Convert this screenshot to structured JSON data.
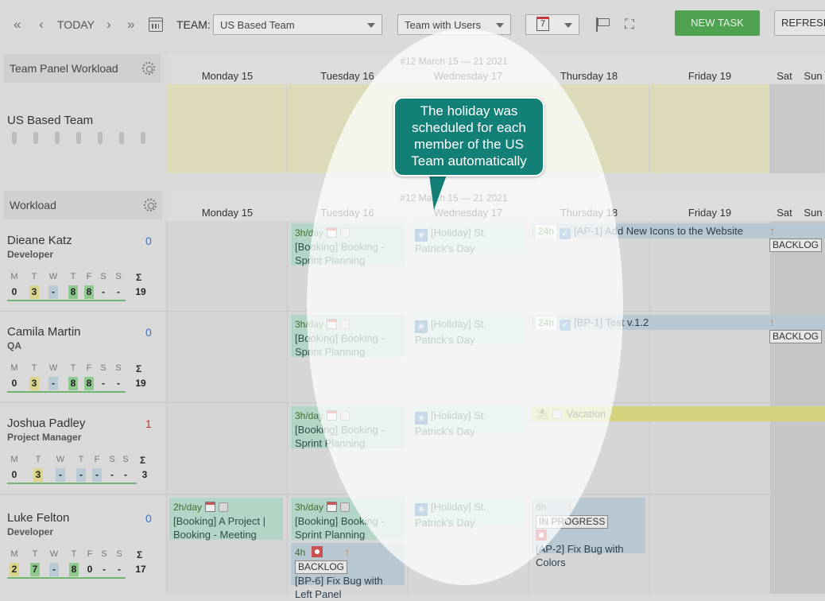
{
  "toolbar": {
    "today_label": "TODAY",
    "team_label": "TEAM:",
    "team_select_value": "US Based Team",
    "view_select_value": "Team with Users",
    "day_number": "7",
    "new_task_label": "NEW TASK",
    "refresh_label": "REFRESH",
    "icons": [
      "double-chevron-left-icon",
      "chevron-left-icon",
      "chevron-right-icon",
      "double-chevron-right-icon",
      "calendar-grid-icon",
      "calendar-day-icon",
      "flag-icon",
      "expand-icon"
    ]
  },
  "team_panel": {
    "title": "Team Panel Workload",
    "team_name": "US Based Team",
    "week_label": "#12 March 15 — 21 2021"
  },
  "workload_panel": {
    "title": "Workload",
    "week_label": "#12 March 15 — 21 2021"
  },
  "days": [
    "Monday 15",
    "Tuesday 16",
    "Wednesday 17",
    "Thursday 18",
    "Friday 19",
    "Sat",
    "Sun"
  ],
  "weekday_letters": [
    "M",
    "T",
    "W",
    "T",
    "F",
    "S",
    "S",
    "Σ"
  ],
  "members": [
    {
      "name": "Dieane Katz",
      "role": "Developer",
      "count": "0",
      "count_color": "#3b73c0",
      "week_values": [
        "0",
        "3",
        "-",
        "8",
        "8",
        "-",
        "-"
      ],
      "total": "19"
    },
    {
      "name": "Camila Martin",
      "role": "QA",
      "count": "0",
      "count_color": "#3b73c0",
      "week_values": [
        "0",
        "3",
        "-",
        "8",
        "8",
        "-",
        "-"
      ],
      "total": "19"
    },
    {
      "name": "Joshua Padley",
      "role": "Project Manager",
      "count": "1",
      "count_color": "#c0392b",
      "week_values": [
        "0",
        "3",
        "-",
        "-",
        "-",
        "-",
        "-"
      ],
      "total": "3"
    },
    {
      "name": "Luke Felton",
      "role": "Developer",
      "count": "0",
      "count_color": "#3b73c0",
      "week_values": [
        "2",
        "7",
        "-",
        "8",
        "0",
        "-",
        "-"
      ],
      "total": "17"
    }
  ],
  "cards": {
    "booking_rate": "3h/day",
    "booking_text": "[Booking] Booking - Sprint Planning",
    "holiday_text": "[Holiday] St. Patrick's Day",
    "task1_hours": "24h",
    "task1_text": "[AP-1] Add New Icons to the Website",
    "task1_status": "BACKLOG",
    "task2_hours": "24h",
    "task2_text": "[BP-1] Test v.1.2",
    "task2_status": "BACKLOG",
    "vacation_text": "Vacation",
    "luke_mon_rate": "2h/day",
    "luke_mon_text": "[Booking] A Project | Booking - Meeting",
    "bp6_hours": "4h",
    "bp6_status": "BACKLOG",
    "bp6_text": "[BP-6] Fix Bug with Left Panel",
    "ap2_hours": "8h",
    "ap2_status": "IN PROGRESS",
    "ap2_text": "[AP-2] Fix Bug with Colors"
  },
  "callout": {
    "text": "The holiday was scheduled for each member of the US Team automatically"
  }
}
